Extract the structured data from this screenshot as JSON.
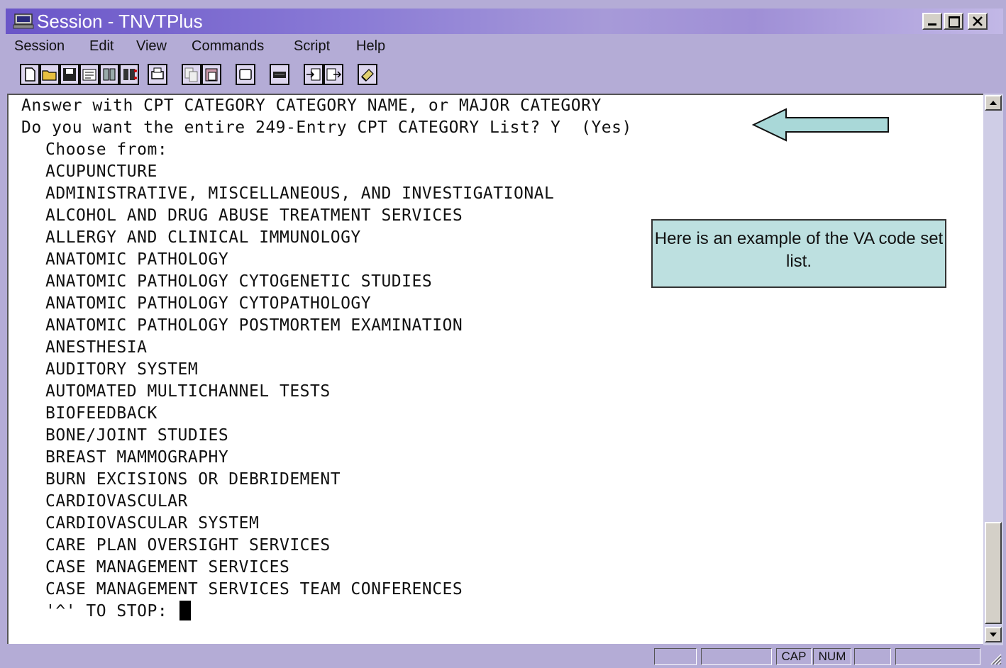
{
  "window": {
    "title": "Session - TNVTPlus",
    "controls": [
      "minimize",
      "maximize",
      "close"
    ]
  },
  "menu": [
    "Session",
    "Edit",
    "View",
    "Commands",
    "Script",
    "Help"
  ],
  "toolbar_icons": [
    "new-icon",
    "open-icon",
    "save-icon",
    "properties-icon",
    "connect-icon",
    "disconnect-icon",
    "print-icon",
    "copy-icon",
    "paste-icon",
    "screen-icon",
    "keyboard-icon",
    "send-file-icon",
    "receive-file-icon",
    "script-icon"
  ],
  "terminal": {
    "header_lines": [
      "Answer with CPT CATEGORY CATEGORY NAME, or MAJOR CATEGORY",
      "Do you want the entire 249-Entry CPT CATEGORY List? Y  (Yes)"
    ],
    "choose_label": "Choose from:",
    "items": [
      "ACUPUNCTURE",
      "ADMINISTRATIVE, MISCELLANEOUS, AND INVESTIGATIONAL",
      "ALCOHOL AND DRUG ABUSE TREATMENT SERVICES",
      "ALLERGY AND CLINICAL IMMUNOLOGY",
      "ANATOMIC PATHOLOGY",
      "ANATOMIC PATHOLOGY CYTOGENETIC STUDIES",
      "ANATOMIC PATHOLOGY CYTOPATHOLOGY",
      "ANATOMIC PATHOLOGY POSTMORTEM EXAMINATION",
      "ANESTHESIA",
      "AUDITORY SYSTEM",
      "AUTOMATED MULTICHANNEL TESTS",
      "BIOFEEDBACK",
      "BONE/JOINT STUDIES",
      "BREAST MAMMOGRAPHY",
      "BURN EXCISIONS OR DEBRIDEMENT",
      "CARDIOVASCULAR",
      "CARDIOVASCULAR SYSTEM",
      "CARE PLAN OVERSIGHT SERVICES",
      "CASE MANAGEMENT SERVICES",
      "CASE MANAGEMENT SERVICES TEAM CONFERENCES"
    ],
    "prompt": "'^' TO STOP:"
  },
  "callout": {
    "text": "Here is an example of the VA code set list."
  },
  "status": {
    "cap": "CAP",
    "num": "NUM"
  },
  "colors": {
    "chrome": "#b4acd6",
    "callout_fill": "#bde0e0",
    "arrow_fill": "#a9d8d8"
  }
}
